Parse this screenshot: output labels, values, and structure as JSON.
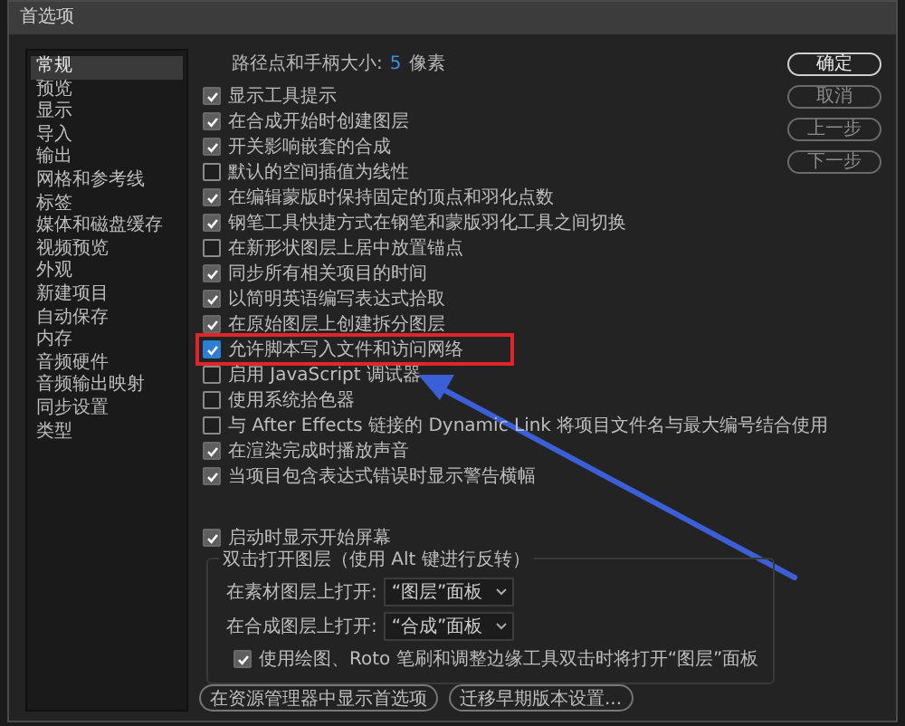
{
  "window": {
    "title": "首选项"
  },
  "sidebar": {
    "items": [
      {
        "label": "常规",
        "selected": true
      },
      {
        "label": "预览",
        "selected": false
      },
      {
        "label": "显示",
        "selected": false
      },
      {
        "label": "导入",
        "selected": false
      },
      {
        "label": "输出",
        "selected": false
      },
      {
        "label": "网格和参考线",
        "selected": false
      },
      {
        "label": "标签",
        "selected": false
      },
      {
        "label": "媒体和磁盘缓存",
        "selected": false
      },
      {
        "label": "视频预览",
        "selected": false
      },
      {
        "label": "外观",
        "selected": false
      },
      {
        "label": "新建项目",
        "selected": false
      },
      {
        "label": "自动保存",
        "selected": false
      },
      {
        "label": "内存",
        "selected": false
      },
      {
        "label": "音频硬件",
        "selected": false
      },
      {
        "label": "音频输出映射",
        "selected": false
      },
      {
        "label": "同步设置",
        "selected": false
      },
      {
        "label": "类型",
        "selected": false
      }
    ]
  },
  "path_size": {
    "label": "路径点和手柄大小:",
    "value": "5",
    "unit": "像素"
  },
  "options": [
    {
      "label": "显示工具提示",
      "checked": true,
      "annotated": false
    },
    {
      "label": "在合成开始时创建图层",
      "checked": true,
      "annotated": false
    },
    {
      "label": "开关影响嵌套的合成",
      "checked": true,
      "annotated": false
    },
    {
      "label": "默认的空间插值为线性",
      "checked": false,
      "annotated": false
    },
    {
      "label": "在编辑蒙版时保持固定的顶点和羽化点数",
      "checked": true,
      "annotated": false
    },
    {
      "label": "钢笔工具快捷方式在钢笔和蒙版羽化工具之间切换",
      "checked": true,
      "annotated": false
    },
    {
      "label": "在新形状图层上居中放置锚点",
      "checked": false,
      "annotated": false
    },
    {
      "label": "同步所有相关项目的时间",
      "checked": true,
      "annotated": false
    },
    {
      "label": "以简明英语编写表达式拾取",
      "checked": true,
      "annotated": false
    },
    {
      "label": "在原始图层上创建拆分图层",
      "checked": true,
      "annotated": false
    },
    {
      "label": "允许脚本写入文件和访问网络",
      "checked": true,
      "annotated": true
    },
    {
      "label": "启用 JavaScript 调试器",
      "checked": false,
      "annotated": false
    },
    {
      "label": "使用系统拾色器",
      "checked": false,
      "annotated": false
    },
    {
      "label": "与 After Effects 链接的 Dynamic Link 将项目文件名与最大编号结合使用",
      "checked": false,
      "annotated": false
    },
    {
      "label": "在渲染完成时播放声音",
      "checked": true,
      "annotated": false
    },
    {
      "label": "当项目包含表达式错误时显示警告横幅",
      "checked": true,
      "annotated": false
    }
  ],
  "startup": {
    "label": "启动时显示开始屏幕",
    "checked": true
  },
  "double_click": {
    "title": "双击打开图层（使用 Alt 键进行反转）",
    "dropdowns": [
      {
        "label": "在素材图层上打开:",
        "value": "“图层”面板"
      },
      {
        "label": "在合成图层上打开:",
        "value": "“合成”面板"
      }
    ],
    "option": {
      "label": "使用绘图、Roto 笔刷和调整边缘工具双击时将打开“图层”面板",
      "checked": true
    }
  },
  "bottom_buttons": [
    "在资源管理器中显示首选项",
    "迁移早期版本设置..."
  ],
  "buttons": [
    {
      "label": "确定",
      "kind": "primary"
    },
    {
      "label": "取消",
      "kind": "normal"
    },
    {
      "label": "上一步",
      "kind": "normal"
    },
    {
      "label": "下一步",
      "kind": "normal"
    }
  ],
  "annotation": {
    "kind": "arrow"
  }
}
